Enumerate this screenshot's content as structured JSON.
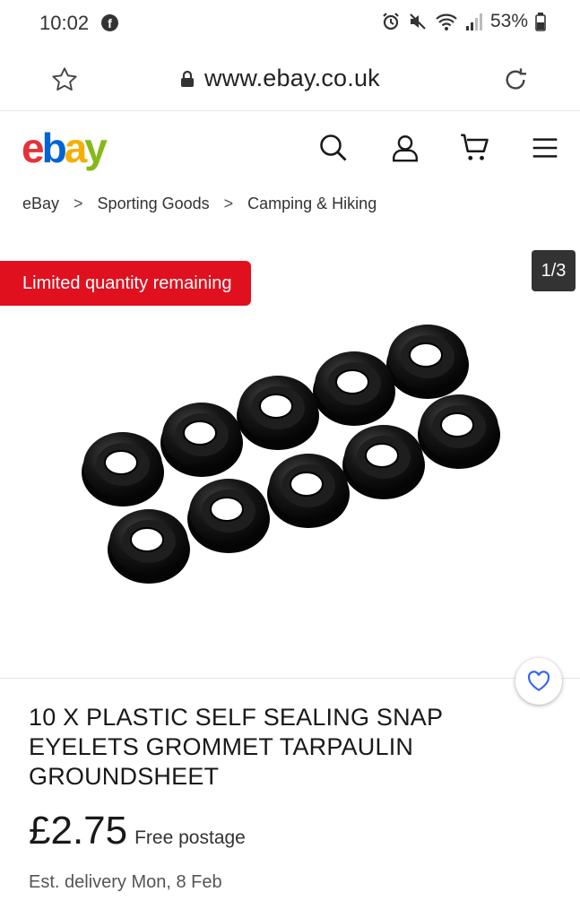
{
  "status": {
    "time": "10:02",
    "battery": "53%"
  },
  "browser": {
    "url": "www.ebay.co.uk"
  },
  "logo": {
    "e": "e",
    "b": "b",
    "a": "a",
    "y": "y"
  },
  "breadcrumb": [
    "eBay",
    "Sporting Goods",
    "Camping & Hiking"
  ],
  "breadcrumb_sep": ">",
  "gallery": {
    "badge": "Limited quantity remaining",
    "counter": "1/3"
  },
  "product": {
    "title": "10 X PLASTIC SELF SEALING SNAP EYELETS GROMMET TARPAULIN GROUNDSHEET",
    "price": "£2.75",
    "postage": "Free postage",
    "delivery": "Est. delivery Mon, 8 Feb"
  },
  "colors": {
    "logo_e": "#e53238",
    "logo_b": "#0064d2",
    "logo_a": "#f5af02",
    "logo_y": "#86b817",
    "badge": "#e0101f",
    "watch": "#3665f3"
  },
  "icons": {
    "star": "star-icon",
    "lock": "lock-icon",
    "reload": "reload-icon",
    "search": "search-icon",
    "user": "user-icon",
    "cart": "cart-icon",
    "menu": "menu-icon",
    "heart": "heart-icon"
  }
}
